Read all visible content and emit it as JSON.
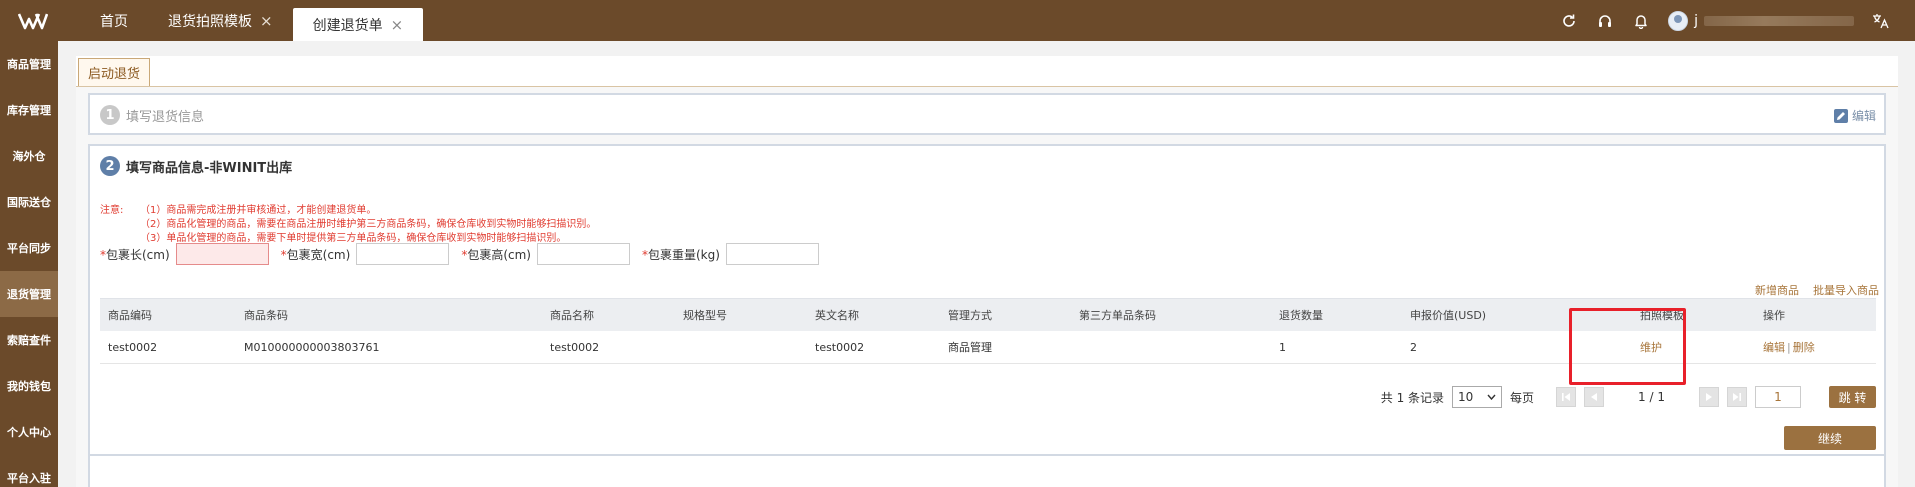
{
  "header": {
    "tabs": [
      {
        "label": "首页",
        "closable": false,
        "active": false
      },
      {
        "label": "退货拍照模板",
        "closable": true,
        "active": false
      },
      {
        "label": "创建退货单",
        "closable": true,
        "active": true
      }
    ],
    "close_glyph": "×",
    "user_initial": "j",
    "icons": [
      "refresh-icon",
      "headset-icon",
      "bell-icon",
      "translate-icon"
    ]
  },
  "sidebar": {
    "items": [
      "商品管理",
      "库存管理",
      "海外仓",
      "国际送仓",
      "平台同步",
      "退货管理",
      "索赔查件",
      "我的钱包",
      "个人中心",
      "平台入驻"
    ],
    "active_index": 5
  },
  "subtab": {
    "label": "启动退货"
  },
  "step1": {
    "number": "1",
    "title": "填写退货信息",
    "edit_label": "编辑"
  },
  "step2": {
    "number": "2",
    "title": "填写商品信息-非WINIT出库",
    "notes": {
      "lead": "注意:",
      "lines": [
        "（1）商品需完成注册并审核通过，才能创建退货单。",
        "（2）商品化管理的商品，需要在商品注册时维护第三方商品条码，确保仓库收到实物时能够扫描识别。",
        "（3）单品化管理的商品，需要下单时提供第三方单品条码，确保仓库收到实物时能够扫描识别。"
      ]
    },
    "dimensions": [
      {
        "label": "包裹长(cm)",
        "value": "",
        "error": true
      },
      {
        "label": "包裹宽(cm)",
        "value": "",
        "error": false
      },
      {
        "label": "包裹高(cm)",
        "value": "",
        "error": false
      },
      {
        "label": "包裹重量(kg)",
        "value": "",
        "error": false
      }
    ],
    "required_mark": "*",
    "links": {
      "add_product": "新增商品",
      "bulk_import": "批量导入商品"
    },
    "table": {
      "headers": [
        "商品编码",
        "商品条码",
        "商品名称",
        "规格型号",
        "英文名称",
        "管理方式",
        "第三方单品条码",
        "退货数量",
        "申报价值(USD)",
        "拍照模板",
        "操作"
      ],
      "rows": [
        {
          "code": "test0002",
          "barcode": "M010000000003803761",
          "name": "test0002",
          "spec": "",
          "en_name": "test0002",
          "mgmt": "商品管理",
          "third_barcode": "",
          "qty": "1",
          "value": "2",
          "template_action": "维护",
          "edit": "编辑",
          "sep": "|",
          "delete": "删除"
        }
      ]
    },
    "pager": {
      "summary": "共 1 条记录",
      "page_size": "10",
      "per_page_label": "每页",
      "page_info": "1 / 1",
      "page_input": "1",
      "go_label": "跳 转"
    },
    "continue_label": "继续"
  },
  "colors": {
    "brand": "#6b4a2a",
    "accent": "#9b7140",
    "link": "#a8753a",
    "warning": "#e03c31",
    "highlight": "#e8202a"
  }
}
